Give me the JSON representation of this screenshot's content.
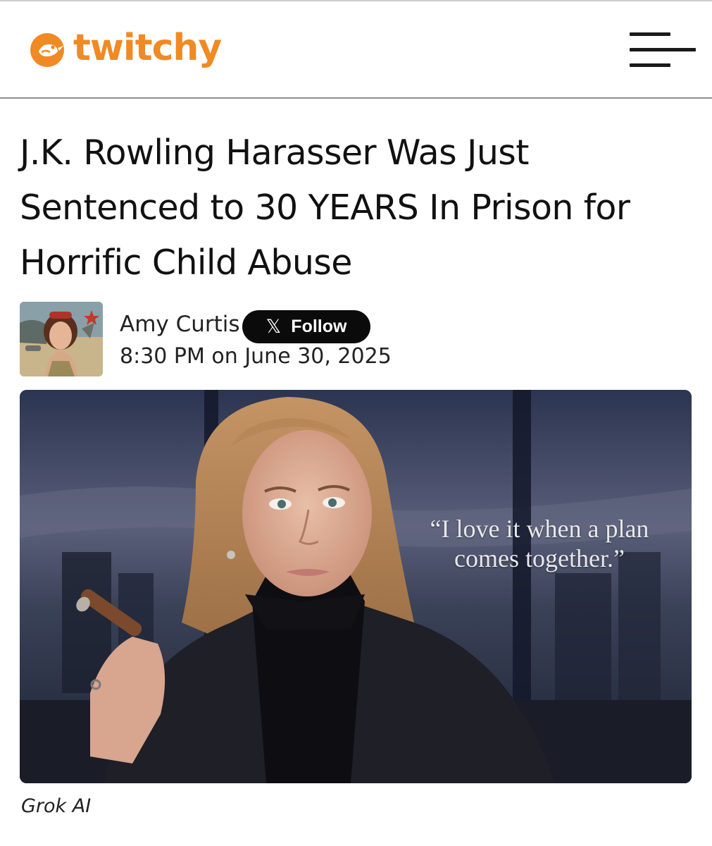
{
  "brand": {
    "name": "twitchy",
    "color": "#f08a24"
  },
  "menu": {
    "icon": "hamburger-menu-icon"
  },
  "article": {
    "title": "J.K. Rowling Harasser Was Just Sentenced to 30 YEARS In Prison for Horrific Child Abuse",
    "author": {
      "name": "Amy Curtis",
      "follow_label": "Follow",
      "follow_icon": "x-logo-icon"
    },
    "timestamp": "8:30 PM on June 30, 2025",
    "image": {
      "quote": "“I love it when a plan comes together.”",
      "caption": "Grok AI"
    }
  }
}
